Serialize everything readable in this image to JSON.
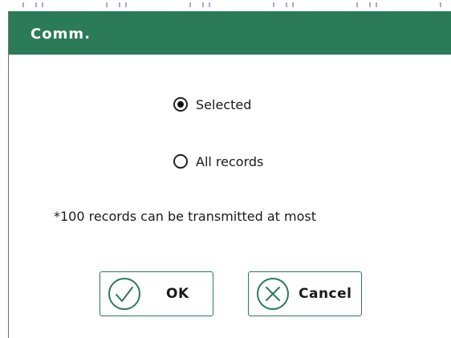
{
  "dialog": {
    "title": "Comm.",
    "options": [
      {
        "label": "Selected",
        "checked": true
      },
      {
        "label": "All records",
        "checked": false
      }
    ],
    "note": "*100 records can be transmitted at most",
    "ok_label": "OK",
    "cancel_label": "Cancel"
  },
  "colors": {
    "title_bar": "#2b7a58",
    "accent": "#2b7a58",
    "text": "#1a1a1a"
  },
  "icons": {
    "ok": "check-circle-icon",
    "cancel": "x-circle-icon"
  }
}
